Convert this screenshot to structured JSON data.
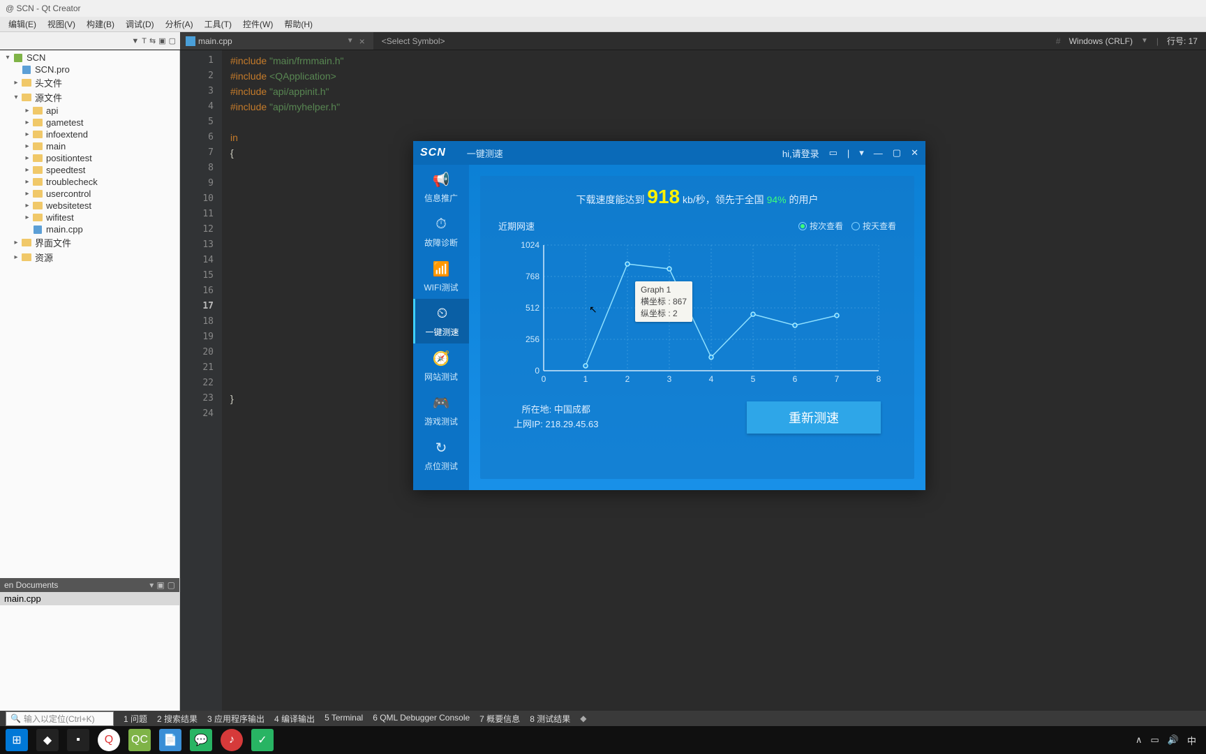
{
  "titlebar": {
    "text": "@ SCN - Qt Creator"
  },
  "menu": [
    "编辑(E)",
    "视图(V)",
    "构建(B)",
    "调试(D)",
    "分析(A)",
    "工具(T)",
    "控件(W)",
    "帮助(H)"
  ],
  "filetab": {
    "name": "main.cpp",
    "symbol": "<Select Symbol>"
  },
  "right_status": {
    "encoding": "Windows (CRLF)",
    "line": "行号: 17"
  },
  "tree": {
    "root": "SCN",
    "pro": "SCN.pro",
    "headers": "头文件",
    "sources": "源文件",
    "folders": [
      "api",
      "gametest",
      "infoextend",
      "main",
      "positiontest",
      "speedtest",
      "troublecheck",
      "usercontrol",
      "websitetest",
      "wifitest"
    ],
    "maincpp": "main.cpp",
    "forms": "界面文件",
    "res": "资源"
  },
  "opendocs": {
    "title": "en Documents",
    "items": [
      "main.cpp"
    ]
  },
  "code": {
    "lines": [
      {
        "n": 1,
        "tok": [
          [
            "kw",
            "#include "
          ],
          [
            "str",
            "\"main/frmmain.h\""
          ]
        ]
      },
      {
        "n": 2,
        "tok": [
          [
            "kw",
            "#include "
          ],
          [
            "inc",
            "<QApplication>"
          ]
        ]
      },
      {
        "n": 3,
        "tok": [
          [
            "kw",
            "#include "
          ],
          [
            "str",
            "\"api/appinit.h\""
          ]
        ]
      },
      {
        "n": 4,
        "tok": [
          [
            "kw",
            "#include "
          ],
          [
            "str",
            "\"api/myhelper.h\""
          ]
        ]
      },
      {
        "n": 5,
        "tok": []
      },
      {
        "n": 6,
        "tok": [
          [
            "kw",
            "in"
          ]
        ]
      },
      {
        "n": 7,
        "tok": [
          [
            "brace",
            "{"
          ]
        ]
      },
      {
        "n": 8,
        "tok": []
      },
      {
        "n": 9,
        "tok": []
      },
      {
        "n": 10,
        "tok": []
      },
      {
        "n": 11,
        "tok": []
      },
      {
        "n": 12,
        "tok": []
      },
      {
        "n": 13,
        "tok": []
      },
      {
        "n": 14,
        "tok": []
      },
      {
        "n": 15,
        "tok": []
      },
      {
        "n": 16,
        "tok": []
      },
      {
        "n": 17,
        "tok": [],
        "current": true
      },
      {
        "n": 18,
        "tok": []
      },
      {
        "n": 19,
        "tok": []
      },
      {
        "n": 20,
        "tok": []
      },
      {
        "n": 21,
        "tok": []
      },
      {
        "n": 22,
        "tok": []
      },
      {
        "n": 23,
        "tok": [
          [
            "brace",
            "}"
          ]
        ]
      },
      {
        "n": 24,
        "tok": []
      }
    ]
  },
  "app": {
    "logo": "SCN",
    "title": "一键测速",
    "greeting": "hi,请登录",
    "sidebar": [
      {
        "label": "信息推广",
        "icon": "📢"
      },
      {
        "label": "故障诊断",
        "icon": "⏱"
      },
      {
        "label": "WIFI测试",
        "icon": "📶"
      },
      {
        "label": "一键测速",
        "icon": "⏲",
        "active": true
      },
      {
        "label": "网站测试",
        "icon": "🧭"
      },
      {
        "label": "游戏测试",
        "icon": "🎮"
      },
      {
        "label": "点位测试",
        "icon": "↻"
      }
    ],
    "headline": {
      "pre": "下载速度能达到 ",
      "speed": "918",
      "unit": " kb/秒，领先于全国 ",
      "pct": "94%",
      "post": " 的用户"
    },
    "subtitle": "近期网速",
    "radio": {
      "by_time": "按次查看",
      "by_day": "按天查看"
    },
    "tooltip": {
      "title": "Graph 1",
      "x_label": "横坐标 : 867",
      "y_label": "纵坐标 : 2"
    },
    "location_label": "所在地: ",
    "location": "中国成都",
    "ip_label": "上网IP: ",
    "ip": "218.29.45.63",
    "retest": "重新测速"
  },
  "chart_data": {
    "type": "line",
    "title": "近期网速",
    "x": [
      0,
      1,
      2,
      3,
      4,
      5,
      6,
      7,
      8
    ],
    "y": [
      null,
      40,
      870,
      830,
      110,
      460,
      370,
      450,
      null
    ],
    "xlim": [
      0,
      8
    ],
    "ylim": [
      0,
      1024
    ],
    "yticks": [
      0,
      256,
      512,
      768,
      1024
    ],
    "xticks": [
      0,
      1,
      2,
      3,
      4,
      5,
      6,
      7,
      8
    ]
  },
  "output": {
    "locator": "输入以定位(Ctrl+K)",
    "items": [
      "1 问题",
      "2 搜索结果",
      "3 应用程序输出",
      "4 编译输出",
      "5 Terminal",
      "6 QML Debugger Console",
      "7 概要信息",
      "8 测试结果"
    ]
  },
  "taskbar_right": {
    "ime": "中"
  }
}
